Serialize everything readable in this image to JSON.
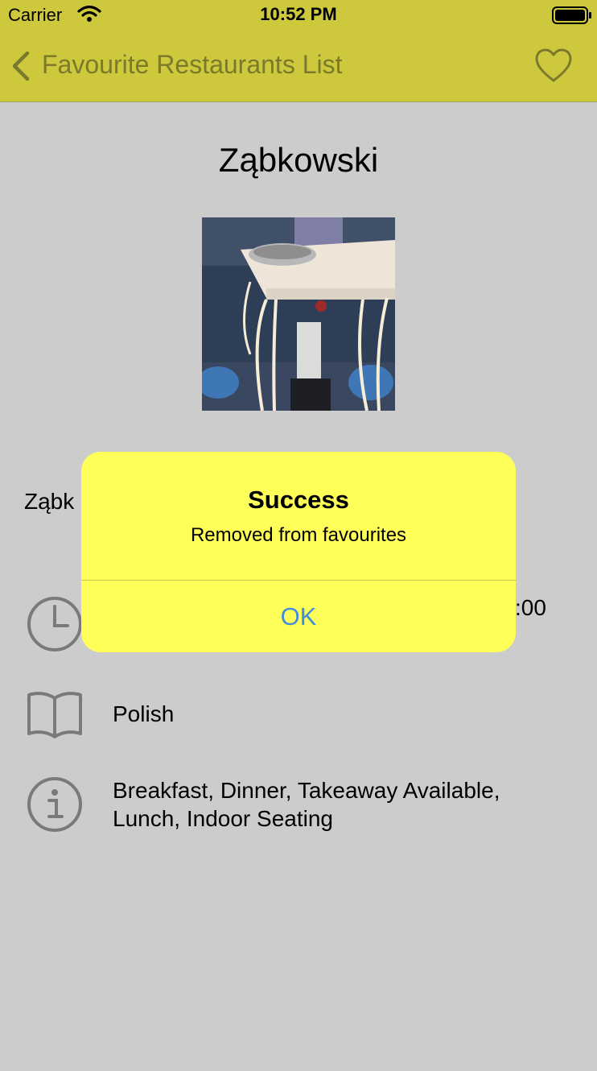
{
  "status_bar": {
    "carrier": "Carrier",
    "time": "10:52 PM",
    "icons": [
      "wifi-icon",
      "battery-icon"
    ]
  },
  "nav": {
    "back_label": "Favourite Restaurants List",
    "favourite_icon": "heart-outline-icon",
    "tint_color": "#7a7a2c",
    "bar_color": "#cdc83c"
  },
  "restaurant": {
    "name": "Ząbkowski",
    "address_partial": "Ząbk",
    "hours_partial": ":00",
    "cuisine": "Polish",
    "features": "Breakfast, Dinner, Takeaway Available, Lunch, Indoor Seating",
    "icons": [
      "clock-icon",
      "book-icon",
      "info-icon"
    ]
  },
  "alert": {
    "title": "Success",
    "message": "Removed from favourites",
    "ok_label": "OK",
    "background": "#ffff5a",
    "button_color": "#3e8ee0"
  }
}
